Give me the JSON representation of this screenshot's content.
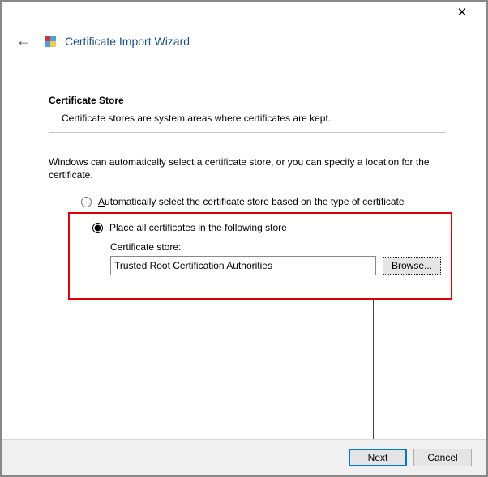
{
  "window": {
    "close": "✕"
  },
  "header": {
    "back": "←",
    "title": "Certificate Import Wizard",
    "icon": "shield-icon"
  },
  "content": {
    "section_title": "Certificate Store",
    "section_desc": "Certificate stores are system areas where certificates are kept.",
    "explain": "Windows can automatically select a certificate store, or you can specify a location for the certificate.",
    "radio_auto": "Automatically select the certificate store based on the type of certificate",
    "radio_place": "Place all certificates in the following store",
    "store_label": "Certificate store:",
    "store_value": "Trusted Root Certification Authorities",
    "browse_label": "Browse..."
  },
  "footer": {
    "next": "Next",
    "cancel": "Cancel"
  }
}
